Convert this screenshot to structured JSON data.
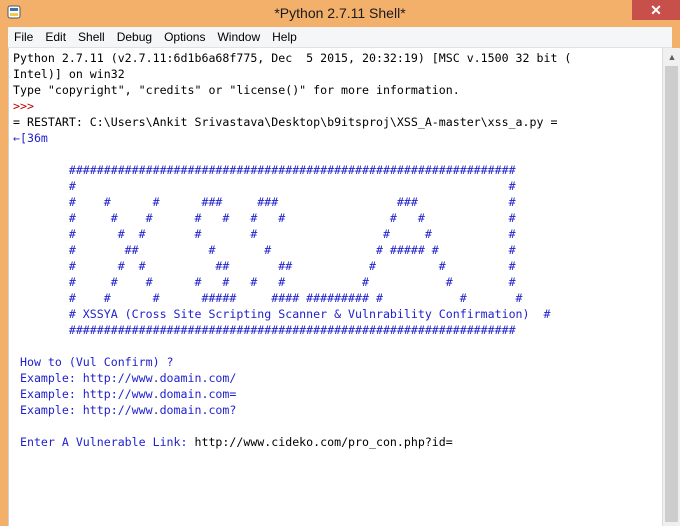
{
  "window": {
    "title": "*Python 2.7.11 Shell*",
    "close_glyph": "✕"
  },
  "menu": [
    "File",
    "Edit",
    "Shell",
    "Debug",
    "Options",
    "Window",
    "Help"
  ],
  "shell": {
    "banner_line1": "Python 2.7.11 (v2.7.11:6d1b6a68f775, Dec  5 2015, 20:32:19) [MSC v.1500 32 bit (",
    "banner_line2": "Intel)] on win32",
    "banner_line3": "Type \"copyright\", \"credits\" or \"license()\" for more information.",
    "prompt": ">>>",
    "restart": "= RESTART: C:\\Users\\Ankit Srivastava\\Desktop\\b9itsproj\\XSS_A-master\\xss_a.py =",
    "escape_line": "←[36m",
    "ascii_art": [
      "        ################################################################",
      "        #                                                              #",
      "        #    #      #      ###     ###                 ###             #",
      "        #     #    #      #   #   #   #               #   #            #",
      "        #      #  #       #       #                  #     #           #",
      "        #       ##          #       #               # ##### #          #",
      "        #      #  #          ##       ##           #         #         #",
      "        #     #    #      #   #   #   #           #           #        #",
      "        #    #      #      #####     #### ######### #           #       #",
      "        # XSSYA (Cross Site Scripting Scanner & Vulnrability Confirmation)  #",
      "        ################################################################"
    ],
    "how_to": " How to (Vul Confirm) ?",
    "examples": [
      " Example: http://www.doamin.com/",
      " Example: http://www.domain.com=",
      " Example: http://www.domain.com?"
    ],
    "enter_label": " Enter A Vulnerable Link: ",
    "enter_value": "http://www.cideko.com/pro_con.php?id="
  },
  "colors": {
    "titlebar": "#f3b06a",
    "close_button": "#c7504b",
    "stdout_blue": "#1f1fcc",
    "prompt_red": "#c00000"
  }
}
